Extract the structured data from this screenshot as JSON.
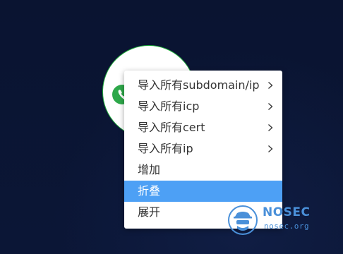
{
  "context_menu": {
    "items": [
      {
        "label": "导入所有subdomain/ip",
        "has_submenu": true
      },
      {
        "label": "导入所有icp",
        "has_submenu": true
      },
      {
        "label": "导入所有cert",
        "has_submenu": true
      },
      {
        "label": "导入所有ip",
        "has_submenu": true
      },
      {
        "label": "增加",
        "has_submenu": false
      },
      {
        "label": "折叠",
        "has_submenu": false,
        "highlighted": true
      },
      {
        "label": "展开",
        "has_submenu": false
      }
    ],
    "highlight_color": "#4da0f5"
  },
  "graph_node": {
    "icon": "phone-icon",
    "border_color": "#1fae3b"
  },
  "watermark": {
    "name": "NOSEC",
    "url": "nosec.org",
    "icon": "hacker-mask-icon"
  },
  "colors": {
    "background": "#0b1433",
    "watermark": "#4a90d9"
  }
}
